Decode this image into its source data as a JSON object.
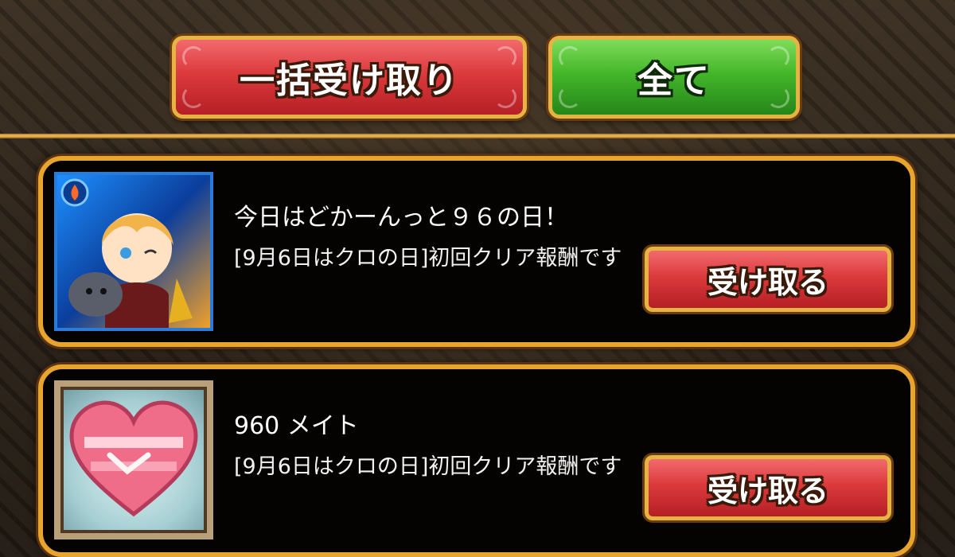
{
  "header": {
    "bulk_receive_label": "一括受け取り",
    "all_label": "全て"
  },
  "rewards": [
    {
      "title": "今日はどかーんっと９６の日！",
      "description": "[9月6日はクロの日]初回クリア報酬です",
      "button_label": "受け取る",
      "icon": "character-card-icon"
    },
    {
      "title": "960 メイト",
      "description": "[9月6日はクロの日]初回クリア報酬です",
      "button_label": "受け取る",
      "icon": "friendship-heart-icon"
    }
  ],
  "colors": {
    "gold_border": "#e8a52e",
    "red_button": "#dc3a3d",
    "green_button": "#44b62a",
    "card_bg": "#050302"
  }
}
